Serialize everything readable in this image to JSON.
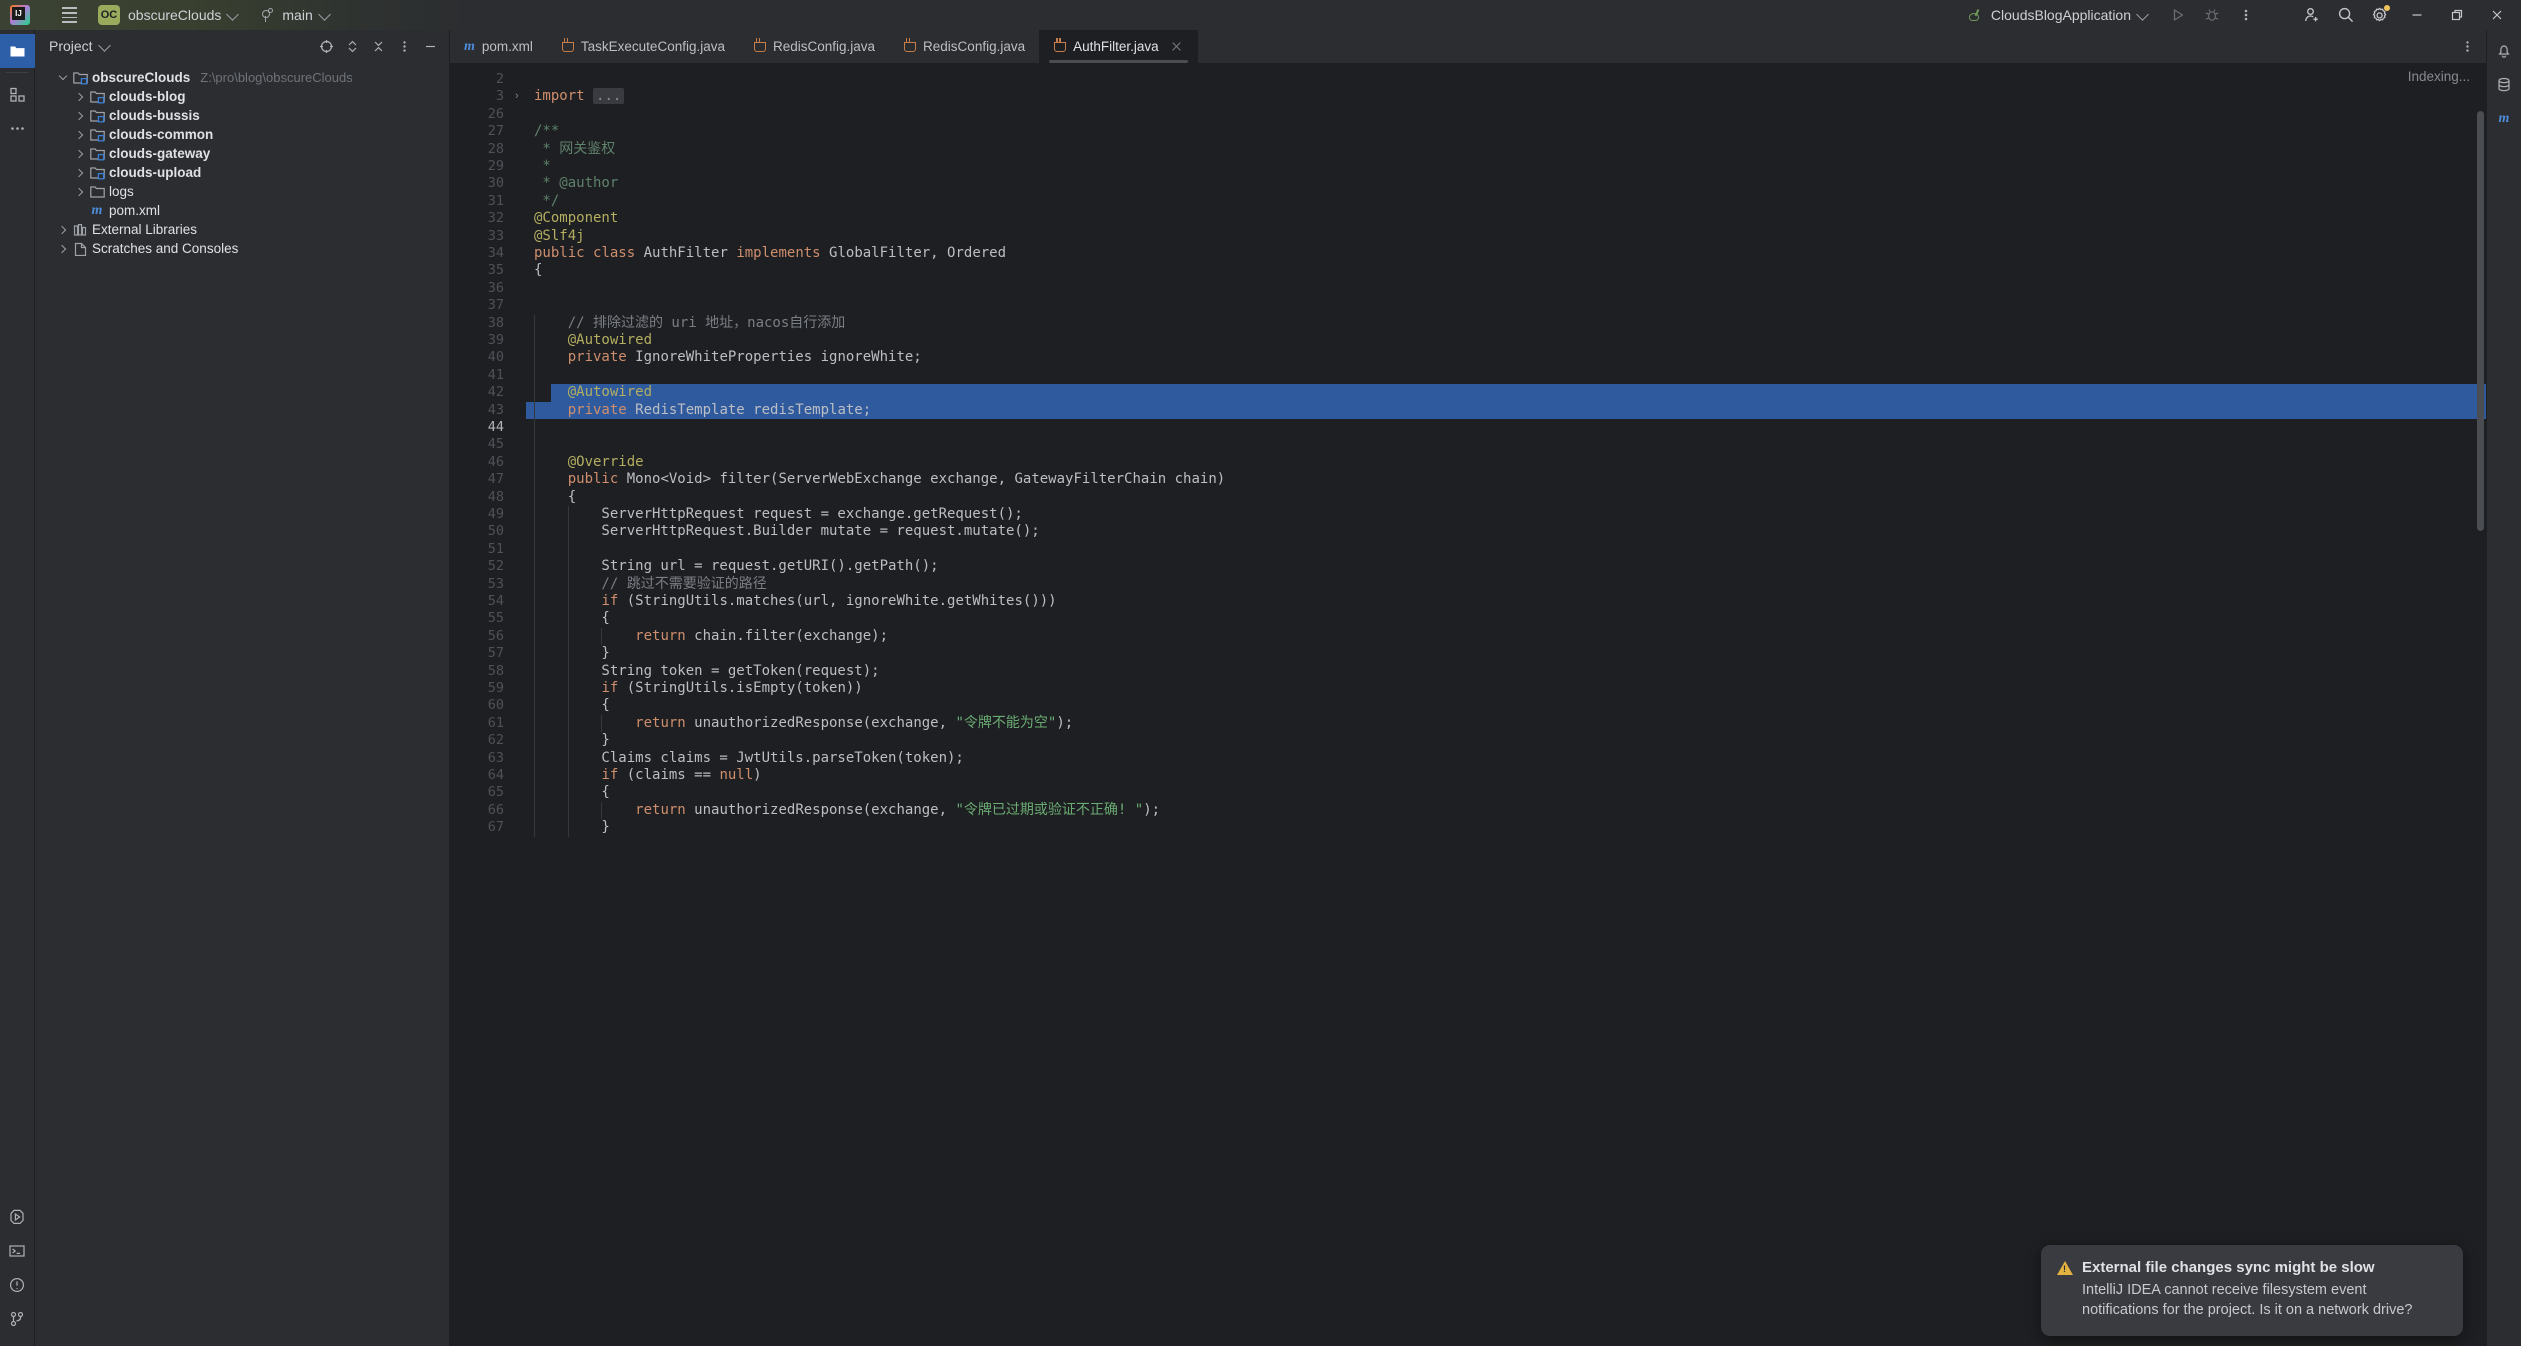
{
  "titlebar": {
    "logo_icon": "intellij-logo-icon",
    "menu_icon": "hamburger-menu-icon",
    "project_badge": "OC",
    "project_name": "obscureClouds",
    "branch_icon": "git-branch-icon",
    "branch_name": "main",
    "run_config_icon": "spring-boot-icon",
    "run_config_name": "CloudsBlogApplication",
    "run_icon": "run-play-icon",
    "debug_icon": "debug-bug-icon",
    "more_icon": "more-vertical-icon",
    "add_user_icon": "add-user-icon",
    "search_icon": "search-icon",
    "settings_icon": "gear-icon",
    "minimize_icon": "window-minimize-icon",
    "maximize_icon": "window-restore-icon",
    "close_icon": "window-close-icon"
  },
  "left_rail": {
    "top": [
      {
        "name": "project-tool-icon",
        "active": true
      },
      {
        "name": "structure-tool-icon",
        "active": false
      },
      {
        "name": "more-tools-icon",
        "active": false
      }
    ],
    "bottom": [
      {
        "name": "run-tool-icon"
      },
      {
        "name": "terminal-tool-icon"
      },
      {
        "name": "problems-tool-icon"
      },
      {
        "name": "git-tool-icon"
      }
    ]
  },
  "right_rail": {
    "items": [
      {
        "name": "notifications-bell-icon"
      },
      {
        "name": "database-icon"
      },
      {
        "name": "maven-icon"
      }
    ]
  },
  "project_panel": {
    "title": "Project",
    "title_chevron_icon": "chevron-down-icon",
    "tools": [
      {
        "name": "select-opened-file-icon"
      },
      {
        "name": "expand-collapse-icon"
      },
      {
        "name": "collapse-all-icon"
      },
      {
        "name": "options-menu-icon"
      },
      {
        "name": "hide-panel-icon"
      }
    ],
    "tree": [
      {
        "depth": 0,
        "arrow": "down",
        "icon": "module-folder-icon",
        "label": "obscureClouds",
        "bold": true,
        "path": "Z:\\pro\\blog\\obscureClouds"
      },
      {
        "depth": 1,
        "arrow": "right",
        "icon": "module-folder-icon",
        "label": "clouds-blog",
        "bold": true,
        "path": ""
      },
      {
        "depth": 1,
        "arrow": "right",
        "icon": "module-folder-icon",
        "label": "clouds-bussis",
        "bold": true,
        "path": ""
      },
      {
        "depth": 1,
        "arrow": "right",
        "icon": "module-folder-icon",
        "label": "clouds-common",
        "bold": true,
        "path": ""
      },
      {
        "depth": 1,
        "arrow": "right",
        "icon": "module-folder-icon",
        "label": "clouds-gateway",
        "bold": true,
        "path": ""
      },
      {
        "depth": 1,
        "arrow": "right",
        "icon": "module-folder-icon",
        "label": "clouds-upload",
        "bold": true,
        "path": ""
      },
      {
        "depth": 1,
        "arrow": "right",
        "icon": "folder-icon",
        "label": "logs",
        "bold": false,
        "path": ""
      },
      {
        "depth": 1,
        "arrow": "none",
        "icon": "maven-file-icon",
        "label": "pom.xml",
        "bold": false,
        "path": ""
      },
      {
        "depth": 0,
        "arrow": "right",
        "icon": "external-libraries-icon",
        "label": "External Libraries",
        "bold": false,
        "path": ""
      },
      {
        "depth": 0,
        "arrow": "right",
        "icon": "scratches-icon",
        "label": "Scratches and Consoles",
        "bold": false,
        "path": ""
      }
    ]
  },
  "editor": {
    "tabs": [
      {
        "label": "pom.xml",
        "icon": "maven-file-icon",
        "active": false,
        "closable": false
      },
      {
        "label": "TaskExecuteConfig.java",
        "icon": "java-class-icon",
        "active": false,
        "closable": false
      },
      {
        "label": "RedisConfig.java",
        "icon": "java-class-icon",
        "active": false,
        "closable": false
      },
      {
        "label": "RedisConfig.java",
        "icon": "java-class-icon",
        "active": false,
        "closable": false
      },
      {
        "label": "AuthFilter.java",
        "icon": "java-class-icon",
        "active": true,
        "closable": true
      }
    ],
    "tabs_more_icon": "more-vertical-icon",
    "status_text": "Indexing...",
    "current_line": 44,
    "selection_lines": [
      42,
      43
    ],
    "lines": [
      {
        "n": 2,
        "indent": 0,
        "fold": false,
        "tokens": []
      },
      {
        "n": 3,
        "indent": 0,
        "fold": true,
        "tokens": [
          {
            "t": "import ",
            "c": "kw"
          },
          {
            "t": "...",
            "c": "foldph"
          }
        ]
      },
      {
        "n": 26,
        "indent": 0,
        "fold": false,
        "tokens": []
      },
      {
        "n": 27,
        "indent": 0,
        "fold": false,
        "tokens": [
          {
            "t": "/**",
            "c": "doc"
          }
        ]
      },
      {
        "n": 28,
        "indent": 0,
        "fold": false,
        "tokens": [
          {
            "t": " * 网关鉴权",
            "c": "doc"
          }
        ]
      },
      {
        "n": 29,
        "indent": 0,
        "fold": false,
        "tokens": [
          {
            "t": " *",
            "c": "doc"
          }
        ]
      },
      {
        "n": 30,
        "indent": 0,
        "fold": false,
        "tokens": [
          {
            "t": " * @author",
            "c": "doc"
          }
        ]
      },
      {
        "n": 31,
        "indent": 0,
        "fold": false,
        "tokens": [
          {
            "t": " */",
            "c": "doc"
          }
        ]
      },
      {
        "n": 32,
        "indent": 0,
        "fold": false,
        "tokens": [
          {
            "t": "@Component",
            "c": "ann"
          }
        ]
      },
      {
        "n": 33,
        "indent": 0,
        "fold": false,
        "tokens": [
          {
            "t": "@Slf4j",
            "c": "ann"
          }
        ]
      },
      {
        "n": 34,
        "indent": 0,
        "fold": false,
        "tokens": [
          {
            "t": "public ",
            "c": "kw"
          },
          {
            "t": "class ",
            "c": "kw"
          },
          {
            "t": "AuthFilter ",
            "c": "txt"
          },
          {
            "t": "implements ",
            "c": "kw"
          },
          {
            "t": "GlobalFilter, Ordered",
            "c": "txt"
          }
        ]
      },
      {
        "n": 35,
        "indent": 0,
        "fold": false,
        "tokens": [
          {
            "t": "{",
            "c": "txt"
          }
        ]
      },
      {
        "n": 36,
        "indent": 0,
        "fold": false,
        "tokens": []
      },
      {
        "n": 37,
        "indent": 0,
        "fold": false,
        "tokens": []
      },
      {
        "n": 38,
        "indent": 1,
        "fold": false,
        "tokens": [
          {
            "t": "    // 排除过滤的 uri 地址，nacos自行添加",
            "c": "cmt"
          }
        ]
      },
      {
        "n": 39,
        "indent": 1,
        "fold": false,
        "tokens": [
          {
            "t": "    @Autowired",
            "c": "ann"
          }
        ]
      },
      {
        "n": 40,
        "indent": 1,
        "fold": false,
        "tokens": [
          {
            "t": "    ",
            "c": "txt"
          },
          {
            "t": "private ",
            "c": "kw"
          },
          {
            "t": "IgnoreWhiteProperties ignoreWhite;",
            "c": "txt"
          }
        ]
      },
      {
        "n": 41,
        "indent": 1,
        "fold": false,
        "tokens": []
      },
      {
        "n": 42,
        "indent": 1,
        "fold": false,
        "tokens": [
          {
            "t": "    @Autowired",
            "c": "ann"
          }
        ]
      },
      {
        "n": 43,
        "indent": 1,
        "fold": false,
        "tokens": [
          {
            "t": "    ",
            "c": "txt"
          },
          {
            "t": "private ",
            "c": "kw"
          },
          {
            "t": "RedisTemplate redisTemplate;",
            "c": "txt"
          }
        ]
      },
      {
        "n": 44,
        "indent": 1,
        "fold": false,
        "tokens": []
      },
      {
        "n": 45,
        "indent": 1,
        "fold": false,
        "tokens": []
      },
      {
        "n": 46,
        "indent": 1,
        "fold": false,
        "tokens": [
          {
            "t": "    @Override",
            "c": "ann"
          }
        ]
      },
      {
        "n": 47,
        "indent": 1,
        "fold": false,
        "tokens": [
          {
            "t": "    ",
            "c": "txt"
          },
          {
            "t": "public ",
            "c": "kw"
          },
          {
            "t": "Mono<Void> filter(ServerWebExchange exchange, GatewayFilterChain chain)",
            "c": "txt"
          }
        ]
      },
      {
        "n": 48,
        "indent": 1,
        "fold": false,
        "tokens": [
          {
            "t": "    {",
            "c": "txt"
          }
        ]
      },
      {
        "n": 49,
        "indent": 2,
        "fold": false,
        "tokens": [
          {
            "t": "        ServerHttpRequest request = exchange.getRequest();",
            "c": "txt"
          }
        ]
      },
      {
        "n": 50,
        "indent": 2,
        "fold": false,
        "tokens": [
          {
            "t": "        ServerHttpRequest.Builder mutate = request.mutate();",
            "c": "txt"
          }
        ]
      },
      {
        "n": 51,
        "indent": 2,
        "fold": false,
        "tokens": []
      },
      {
        "n": 52,
        "indent": 2,
        "fold": false,
        "tokens": [
          {
            "t": "        String url = request.getURI().getPath();",
            "c": "txt"
          }
        ]
      },
      {
        "n": 53,
        "indent": 2,
        "fold": false,
        "tokens": [
          {
            "t": "        // 跳过不需要验证的路径",
            "c": "cmt"
          }
        ]
      },
      {
        "n": 54,
        "indent": 2,
        "fold": false,
        "tokens": [
          {
            "t": "        ",
            "c": "txt"
          },
          {
            "t": "if ",
            "c": "kw"
          },
          {
            "t": "(StringUtils.matches(url, ignoreWhite.getWhites()))",
            "c": "txt"
          }
        ]
      },
      {
        "n": 55,
        "indent": 2,
        "fold": false,
        "tokens": [
          {
            "t": "        {",
            "c": "txt"
          }
        ]
      },
      {
        "n": 56,
        "indent": 3,
        "fold": false,
        "tokens": [
          {
            "t": "            ",
            "c": "txt"
          },
          {
            "t": "return ",
            "c": "kw"
          },
          {
            "t": "chain.filter(exchange);",
            "c": "txt"
          }
        ]
      },
      {
        "n": 57,
        "indent": 2,
        "fold": false,
        "tokens": [
          {
            "t": "        }",
            "c": "txt"
          }
        ]
      },
      {
        "n": 58,
        "indent": 2,
        "fold": false,
        "tokens": [
          {
            "t": "        String token = getToken(request);",
            "c": "txt"
          }
        ]
      },
      {
        "n": 59,
        "indent": 2,
        "fold": false,
        "tokens": [
          {
            "t": "        ",
            "c": "txt"
          },
          {
            "t": "if ",
            "c": "kw"
          },
          {
            "t": "(StringUtils.isEmpty(token))",
            "c": "txt"
          }
        ]
      },
      {
        "n": 60,
        "indent": 2,
        "fold": false,
        "tokens": [
          {
            "t": "        {",
            "c": "txt"
          }
        ]
      },
      {
        "n": 61,
        "indent": 3,
        "fold": false,
        "tokens": [
          {
            "t": "            ",
            "c": "txt"
          },
          {
            "t": "return ",
            "c": "kw"
          },
          {
            "t": "unauthorizedResponse(exchange, ",
            "c": "txt"
          },
          {
            "t": "\"令牌不能为空\"",
            "c": "str"
          },
          {
            "t": ");",
            "c": "txt"
          }
        ]
      },
      {
        "n": 62,
        "indent": 2,
        "fold": false,
        "tokens": [
          {
            "t": "        }",
            "c": "txt"
          }
        ]
      },
      {
        "n": 63,
        "indent": 2,
        "fold": false,
        "tokens": [
          {
            "t": "        Claims claims = JwtUtils.parseToken(token);",
            "c": "txt"
          }
        ]
      },
      {
        "n": 64,
        "indent": 2,
        "fold": false,
        "tokens": [
          {
            "t": "        ",
            "c": "txt"
          },
          {
            "t": "if ",
            "c": "kw"
          },
          {
            "t": "(claims == ",
            "c": "txt"
          },
          {
            "t": "null",
            "c": "kw"
          },
          {
            "t": ")",
            "c": "txt"
          }
        ]
      },
      {
        "n": 65,
        "indent": 2,
        "fold": false,
        "tokens": [
          {
            "t": "        {",
            "c": "txt"
          }
        ]
      },
      {
        "n": 66,
        "indent": 3,
        "fold": false,
        "tokens": [
          {
            "t": "            ",
            "c": "txt"
          },
          {
            "t": "return ",
            "c": "kw"
          },
          {
            "t": "unauthorizedResponse(exchange, ",
            "c": "txt"
          },
          {
            "t": "\"令牌已过期或验证不正确! \"",
            "c": "str"
          },
          {
            "t": ");",
            "c": "txt"
          }
        ]
      },
      {
        "n": 67,
        "indent": 2,
        "fold": false,
        "tokens": [
          {
            "t": "        }",
            "c": "txt"
          }
        ]
      }
    ]
  },
  "notification": {
    "warning_icon": "warning-triangle-icon",
    "title": "External file changes sync might be slow",
    "body": "IntelliJ IDEA cannot receive filesystem event notifications for the project. Is it on a network drive?"
  },
  "colors": {
    "accent_blue": "#2c5fa8",
    "selection_blue": "#2f5b9e",
    "panel_bg": "#2b2d30",
    "editor_bg": "#1e1f22",
    "badge_green": "#9aab5e",
    "warning_yellow": "#e3b341"
  }
}
